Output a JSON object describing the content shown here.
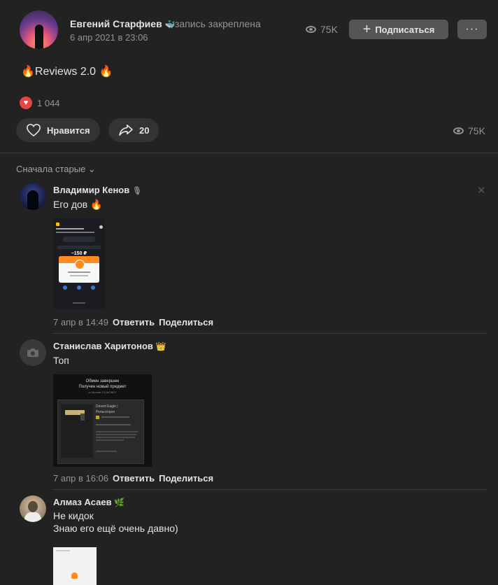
{
  "post": {
    "author": "Евгений Старфиев",
    "author_badge_icon": "whale-icon",
    "pinned_text": "запись закреплена",
    "date": "6 апр 2021 в 23:06",
    "views": "75K",
    "subscribe_label": "Подписаться",
    "more_label": "···",
    "text": "Reviews 2.0",
    "likes_count": "1 044",
    "like_label": "Нравится",
    "share_count": "20",
    "views_bottom": "75K"
  },
  "comments_sort": "Сначала старые",
  "comments": [
    {
      "name": "Владимир Кенов",
      "text": "Его дов",
      "date": "7 апр в 14:49",
      "reply": "Ответить",
      "share": "Поделиться",
      "image": {
        "title": "Тинькофф",
        "status": "Успешно",
        "amount": "−150 ₽"
      }
    },
    {
      "name": "Станислав Харитонов",
      "text": "Топ",
      "date": "7 апр в 16:06",
      "reply": "Ответить",
      "share": "Поделиться",
      "image": {
        "line1": "Обмен завершен",
        "line2": "Получен новый предмет",
        "line3": "от Nomad CS.MONEY",
        "item": "Desert Eagle |",
        "item2": "Рельсотрон"
      }
    },
    {
      "name": "Алмаз Асаев",
      "line1": "Не кидок",
      "line2": "Знаю его ещё очень давно)"
    }
  ],
  "colors": {
    "background": "#222222",
    "button": "#555555",
    "pill": "#333333",
    "like_red": "#e64646",
    "muted_text": "#939393"
  }
}
